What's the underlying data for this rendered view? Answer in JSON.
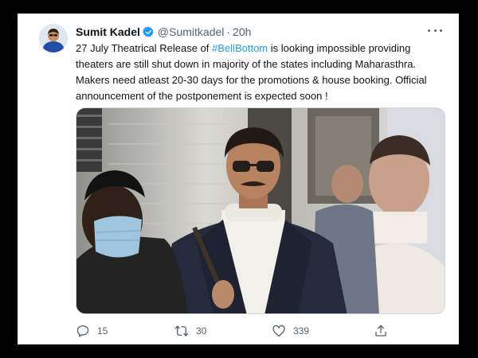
{
  "author": {
    "display_name": "Sumit Kadel",
    "handle": "@Sumitkadel",
    "separator": "·",
    "time": "20h",
    "verified_color": "#1d9bf0"
  },
  "tweet": {
    "text_before": "27 July Theatrical Release of ",
    "hashtag": "#BellBottom",
    "text_after": " is looking impossible providing theaters are still shut down in majority of the states including Maharasthra. Makers need atleast 20-30 days for the promotions & house booking. Official announcement of the postponement is expected soon !"
  },
  "actions": {
    "replies": "15",
    "retweets": "30",
    "likes": "339"
  },
  "colors": {
    "hashtag": "#1d9bf0",
    "muted": "#536471",
    "text": "#0f1419"
  },
  "icons": {
    "more": "more-icon",
    "reply": "reply-icon",
    "retweet": "retweet-icon",
    "like": "like-icon",
    "share": "share-icon"
  }
}
